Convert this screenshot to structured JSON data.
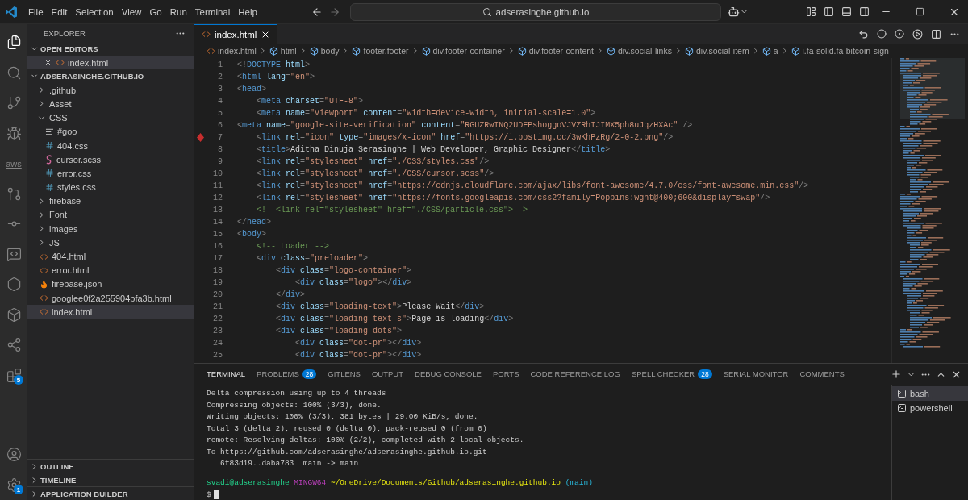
{
  "title_bar": {
    "menu": [
      "File",
      "Edit",
      "Selection",
      "View",
      "Go",
      "Run",
      "Terminal",
      "Help"
    ],
    "search": {
      "value": "adserasinghe.github.io"
    }
  },
  "activity_bar": {
    "top": [
      {
        "selected": true
      },
      {
        "selected": false
      },
      {
        "selected": false
      },
      {
        "selected": false
      },
      {
        "selected": false,
        "text": "aws"
      },
      {
        "selected": false
      },
      {
        "selected": false
      },
      {
        "selected": false
      },
      {
        "selected": false
      },
      {
        "selected": false
      },
      {
        "selected": false
      },
      {
        "selected": false,
        "badge": "5"
      }
    ],
    "bottom": [
      {
        "selected": false
      },
      {
        "selected": false,
        "badge": "1"
      }
    ]
  },
  "explorer": {
    "title": "EXPLORER",
    "open_editors": {
      "title": "OPEN EDITORS",
      "expanded": true,
      "items": [
        {
          "name": "index.html",
          "kind": "html",
          "selected": true
        }
      ]
    },
    "project": {
      "title": "ADSERASINGHE.GITHUB.IO",
      "expanded": true,
      "children": [
        {
          "name": ".github",
          "kind": "folder",
          "expanded": false,
          "selected": false
        },
        {
          "name": "Asset",
          "kind": "folder",
          "expanded": false,
          "selected": false
        },
        {
          "name": "CSS",
          "kind": "folder",
          "expanded": true,
          "selected": false,
          "children": [
            {
              "name": "#goo",
              "kind": "text",
              "selected": false
            },
            {
              "name": "404.css",
              "kind": "css",
              "selected": false
            },
            {
              "name": "cursor.scss",
              "kind": "scss",
              "selected": false
            },
            {
              "name": "error.css",
              "kind": "css",
              "selected": false
            },
            {
              "name": "styles.css",
              "kind": "css",
              "selected": false
            }
          ]
        },
        {
          "name": "firebase",
          "kind": "folder",
          "expanded": false,
          "selected": false
        },
        {
          "name": "Font",
          "kind": "folder",
          "expanded": false,
          "selected": false
        },
        {
          "name": "images",
          "kind": "folder",
          "expanded": false,
          "selected": false
        },
        {
          "name": "JS",
          "kind": "folder",
          "expanded": false,
          "selected": false
        },
        {
          "name": "404.html",
          "kind": "html",
          "selected": false
        },
        {
          "name": "error.html",
          "kind": "html",
          "selected": false
        },
        {
          "name": "firebase.json",
          "kind": "firebase",
          "selected": false
        },
        {
          "name": "googlee0f2a255904bfa3b.html",
          "kind": "html",
          "selected": false
        },
        {
          "name": "index.html",
          "kind": "html",
          "selected": true
        }
      ]
    },
    "sections": [
      {
        "title": "OUTLINE",
        "expanded": false
      },
      {
        "title": "TIMELINE",
        "expanded": false
      },
      {
        "title": "APPLICATION BUILDER",
        "expanded": false
      }
    ]
  },
  "editor": {
    "tabs": [
      {
        "label": "index.html",
        "kind": "html",
        "selected": true
      }
    ],
    "breadcrumbs": [
      {
        "text": "index.html",
        "kind": "file"
      },
      {
        "text": "html",
        "kind": "element"
      },
      {
        "text": "body",
        "kind": "element"
      },
      {
        "text": "footer.footer",
        "kind": "element"
      },
      {
        "text": "div.footer-container",
        "kind": "element"
      },
      {
        "text": "div.footer-content",
        "kind": "element"
      },
      {
        "text": "div.social-links",
        "kind": "element"
      },
      {
        "text": "div.social-item",
        "kind": "element"
      },
      {
        "text": "a",
        "kind": "element"
      },
      {
        "text": "i.fa-solid.fa-bitcoin-sign",
        "kind": "element"
      }
    ],
    "lines": [
      {
        "number": "1",
        "text": "<!DOCTYPE html>",
        "breakpoint": false
      },
      {
        "number": "2",
        "text": "<html lang=\"en\">",
        "breakpoint": false
      },
      {
        "number": "3",
        "text": "<head>",
        "breakpoint": false
      },
      {
        "number": "4",
        "text": "    <meta charset=\"UTF-8\">",
        "breakpoint": false
      },
      {
        "number": "5",
        "text": "    <meta name=\"viewport\" content=\"width=device-width, initial-scale=1.0\">",
        "breakpoint": false
      },
      {
        "number": "6",
        "text": "<meta name=\"google-site-verification\" content=\"RGUZRwINQ2UDFPshoggoVJVZRhIJIMX5ph8uJqzHXAc\" />",
        "breakpoint": false
      },
      {
        "number": "7",
        "text": "    <link rel=\"icon\" type=\"images/x-icon\" href=\"https://i.postimg.cc/3wKhPzRg/2-0-2.png\"/>",
        "breakpoint": true
      },
      {
        "number": "8",
        "text": "    <title>Aditha Dinuja Serasinghe | Web Developer, Graphic Designer</title>",
        "breakpoint": false
      },
      {
        "number": "9",
        "text": "    <link rel=\"stylesheet\" href=\"./CSS/styles.css\"/>",
        "breakpoint": false
      },
      {
        "number": "10",
        "text": "    <link rel=\"stylesheet\" href=\"./CSS/cursor.scss\"/>",
        "breakpoint": false
      },
      {
        "number": "11",
        "text": "    <link rel=\"stylesheet\" href=\"https://cdnjs.cloudflare.com/ajax/libs/font-awesome/4.7.0/css/font-awesome.min.css\"/>",
        "breakpoint": false
      },
      {
        "number": "12",
        "text": "    <link rel=\"stylesheet\" href=\"https://fonts.googleapis.com/css2?family=Poppins:wght@400;600&display=swap\"/>",
        "breakpoint": false
      },
      {
        "number": "13",
        "text": "    <!--<link rel=\"stylesheet\" href=\"./CSS/particle.css\">-->",
        "breakpoint": false
      },
      {
        "number": "14",
        "text": "</head>",
        "breakpoint": false
      },
      {
        "number": "15",
        "text": "<body>",
        "breakpoint": false
      },
      {
        "number": "16",
        "text": "    <!-- Loader -->",
        "breakpoint": false
      },
      {
        "number": "17",
        "text": "    <div class=\"preloader\">",
        "breakpoint": false
      },
      {
        "number": "18",
        "text": "        <div class=\"logo-container\">",
        "breakpoint": false
      },
      {
        "number": "19",
        "text": "            <div class=\"logo\"></div>",
        "breakpoint": false
      },
      {
        "number": "20",
        "text": "        </div>",
        "breakpoint": false
      },
      {
        "number": "21",
        "text": "        <div class=\"loading-text\">Please Wait</div>",
        "breakpoint": false
      },
      {
        "number": "22",
        "text": "        <div class=\"loading-text-s\">Page is loading</div>",
        "breakpoint": false
      },
      {
        "number": "23",
        "text": "        <div class=\"loading-dots\">",
        "breakpoint": false
      },
      {
        "number": "24",
        "text": "            <div class=\"dot-pr\"></div>",
        "breakpoint": false
      },
      {
        "number": "25",
        "text": "            <div class=\"dot-pr\"></div>",
        "breakpoint": false
      }
    ]
  },
  "panel": {
    "tabs": [
      {
        "label": "TERMINAL",
        "selected": true
      },
      {
        "label": "PROBLEMS",
        "selected": false,
        "badge": "28"
      },
      {
        "label": "GITLENS",
        "selected": false
      },
      {
        "label": "OUTPUT",
        "selected": false
      },
      {
        "label": "DEBUG CONSOLE",
        "selected": false
      },
      {
        "label": "PORTS",
        "selected": false
      },
      {
        "label": "CODE REFERENCE LOG",
        "selected": false
      },
      {
        "label": "SPELL CHECKER",
        "selected": false,
        "badge": "28"
      },
      {
        "label": "SERIAL MONITOR",
        "selected": false
      },
      {
        "label": "COMMENTS",
        "selected": false
      }
    ],
    "terminal": {
      "lines": [
        "Delta compression using up to 4 threads",
        "Compressing objects: 100% (3/3), done.",
        "Writing objects: 100% (3/3), 381 bytes | 29.00 KiB/s, done.",
        "Total 3 (delta 2), reused 0 (delta 0), pack-reused 0 (from 0)",
        "remote: Resolving deltas: 100% (2/2), completed with 2 local objects.",
        "To https://github.com/adserasinghe/adserasinghe.github.io.git",
        "   6f83d19..daba783  main -> main"
      ],
      "prompt": {
        "user": "svadi@adserasinghe",
        "system": "MINGW64",
        "path": "~/OneDrive/Documents/Github/adserasinghe.github.io",
        "branch": "(main)"
      },
      "input": {
        "prompt": "$"
      }
    },
    "sessions": [
      {
        "name": "bash",
        "selected": true
      },
      {
        "name": "powershell",
        "selected": false
      }
    ]
  }
}
